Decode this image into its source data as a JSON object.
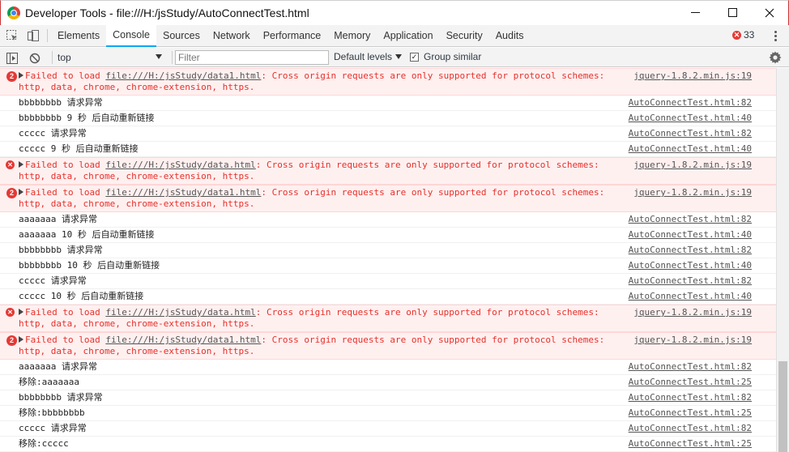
{
  "window": {
    "title": "Developer Tools - file:///H:/jsStudy/AutoConnectTest.html"
  },
  "tabs": [
    "Elements",
    "Console",
    "Sources",
    "Network",
    "Performance",
    "Memory",
    "Application",
    "Security",
    "Audits"
  ],
  "active_tab": "Console",
  "error_count": "33",
  "toolbar": {
    "context": "top",
    "filter_placeholder": "Filter",
    "levels": "Default levels",
    "group_similar": "Group similar",
    "group_similar_checked": true
  },
  "messages": [
    {
      "type": "error",
      "count": "2",
      "pre": "Failed to load ",
      "url": "file:///H:/jsStudy/data1.html",
      "post": ": Cross origin requests are only supported for protocol schemes: http, data, chrome, chrome-extension, https.",
      "source": "jquery-1.8.2.min.js:19"
    },
    {
      "type": "log",
      "text": "bbbbbbbb 请求异常",
      "source": "AutoConnectTest.html:82"
    },
    {
      "type": "log",
      "text": "bbbbbbbb 9 秒 后自动重新链接",
      "source": "AutoConnectTest.html:40"
    },
    {
      "type": "log",
      "text": "ccccc 请求异常",
      "source": "AutoConnectTest.html:82"
    },
    {
      "type": "log",
      "text": "ccccc 9 秒 后自动重新链接",
      "source": "AutoConnectTest.html:40"
    },
    {
      "type": "error",
      "count": "",
      "pre": "Failed to load ",
      "url": "file:///H:/jsStudy/data.html",
      "post": ": Cross origin requests are only supported for protocol schemes: http, data, chrome, chrome-extension, https.",
      "source": "jquery-1.8.2.min.js:19"
    },
    {
      "type": "error",
      "count": "2",
      "pre": "Failed to load ",
      "url": "file:///H:/jsStudy/data1.html",
      "post": ": Cross origin requests are only supported for protocol schemes: http, data, chrome, chrome-extension, https.",
      "source": "jquery-1.8.2.min.js:19"
    },
    {
      "type": "log",
      "text": "aaaaaaa 请求异常",
      "source": "AutoConnectTest.html:82"
    },
    {
      "type": "log",
      "text": "aaaaaaa 10 秒 后自动重新链接",
      "source": "AutoConnectTest.html:40"
    },
    {
      "type": "log",
      "text": "bbbbbbbb 请求异常",
      "source": "AutoConnectTest.html:82"
    },
    {
      "type": "log",
      "text": "bbbbbbbb 10 秒 后自动重新链接",
      "source": "AutoConnectTest.html:40"
    },
    {
      "type": "log",
      "text": "ccccc 请求异常",
      "source": "AutoConnectTest.html:82"
    },
    {
      "type": "log",
      "text": "ccccc 10 秒 后自动重新链接",
      "source": "AutoConnectTest.html:40"
    },
    {
      "type": "error",
      "count": "",
      "pre": "Failed to load ",
      "url": "file:///H:/jsStudy/data.html",
      "post": ": Cross origin requests are only supported for protocol schemes: http, data, chrome, chrome-extension, https.",
      "source": "jquery-1.8.2.min.js:19"
    },
    {
      "type": "error",
      "count": "2",
      "pre": "Failed to load ",
      "url": "file:///H:/jsStudy/data1.html",
      "post": ": Cross origin requests are only supported for protocol schemes: http, data, chrome, chrome-extension, https.",
      "source": "jquery-1.8.2.min.js:19"
    },
    {
      "type": "log",
      "text": "aaaaaaa 请求异常",
      "source": "AutoConnectTest.html:82"
    },
    {
      "type": "log",
      "text": "移除:aaaaaaa",
      "source": "AutoConnectTest.html:25"
    },
    {
      "type": "log",
      "text": "bbbbbbbb 请求异常",
      "source": "AutoConnectTest.html:82"
    },
    {
      "type": "log",
      "text": "移除:bbbbbbbb",
      "source": "AutoConnectTest.html:25"
    },
    {
      "type": "log",
      "text": "ccccc 请求异常",
      "source": "AutoConnectTest.html:82"
    },
    {
      "type": "log",
      "text": "移除:ccccc",
      "source": "AutoConnectTest.html:25"
    }
  ],
  "icons": {
    "select_element": "inspect-icon",
    "device_mode": "device-toolbar-icon",
    "show_drawer": "console-sidebar-icon",
    "clear": "clear-console-icon",
    "settings": "gear-icon",
    "more": "kebab-menu-icon"
  },
  "colors": {
    "error_bg": "#fff0f0",
    "error_text": "#e6302a",
    "active_tab_underline": "#03a9f4",
    "badge_red": "#e53935"
  }
}
